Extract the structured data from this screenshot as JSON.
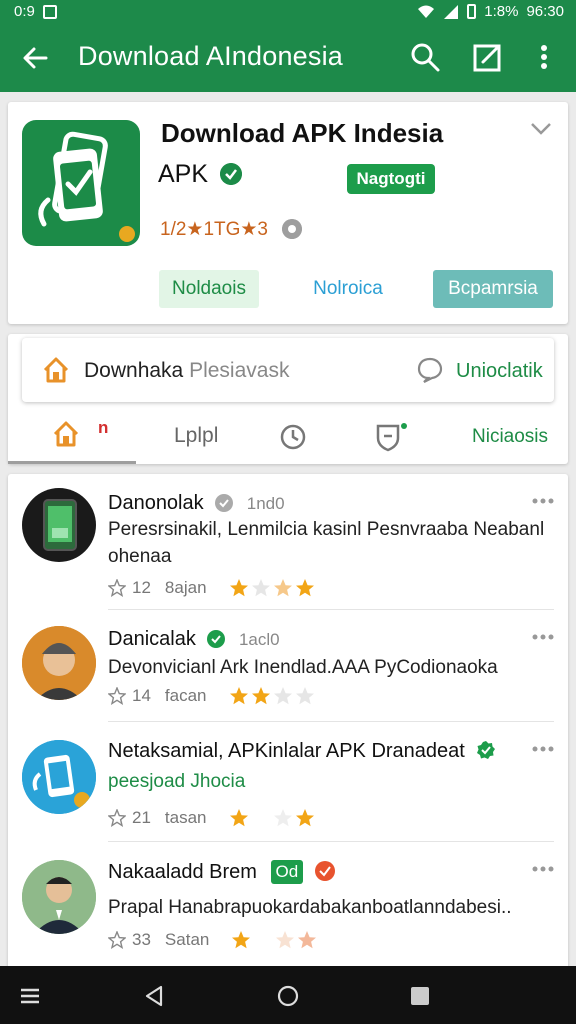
{
  "status_bar": {
    "time_left": "0:9",
    "battery_percent": "1:8%",
    "time_right": "96:30"
  },
  "app_bar": {
    "title": "Download AIndonesia"
  },
  "app_card": {
    "name_line1": "Download APK Indesia",
    "name_line2": "APK",
    "badge": "Nagtogti",
    "rating": "1/2★1TG★3",
    "buttons": [
      "Noldaois",
      "Nolroica",
      "Bcpamrsia"
    ],
    "colors": {
      "brand": "#1d8a4a",
      "badge": "#1d9d4b",
      "rating": "#c8641e",
      "button_teal": "#6dbcb8"
    }
  },
  "search": {
    "prefix": "Downhaka",
    "placeholder": "Plesiavask",
    "action": "Unioclatik"
  },
  "tabs": {
    "items": [
      "home",
      "Lplpl",
      "clock",
      "shield"
    ],
    "home_badge": "n",
    "active": "home",
    "right_label": "Niciaosis"
  },
  "reviews": [
    {
      "name": "Danonolak",
      "time": "1nd0",
      "verified": "gray",
      "body": "Peresrsinakil, Lenmilcia kasinl Pesnvraaba Neabanl ohenaa",
      "count": "12",
      "label": "8ajan",
      "stars": 3,
      "avatar": "phone"
    },
    {
      "name": "Danicalak",
      "time": "1acl0",
      "verified": "green",
      "body": "Devonvicianl Ark Inendlad.AAA PyCodionaoka",
      "count": "14",
      "label": "facan",
      "stars": 2,
      "avatar": "person"
    },
    {
      "name": "Netaksamial, APKinlalar APK Dranadeat",
      "time": "",
      "verified": "green",
      "body": "peesjoad Jhocia",
      "body_green": true,
      "count": "21",
      "label": "tasan",
      "stars": 2,
      "avatar": "app"
    },
    {
      "name": "Nakaaladd Brem",
      "time": "",
      "badge": "Od",
      "verified": "red",
      "body": "Prapal Hanabrapuokardabakanboatlanndabesi..",
      "count": "33",
      "label": "Satan",
      "stars": 2,
      "avatar": "man"
    }
  ]
}
